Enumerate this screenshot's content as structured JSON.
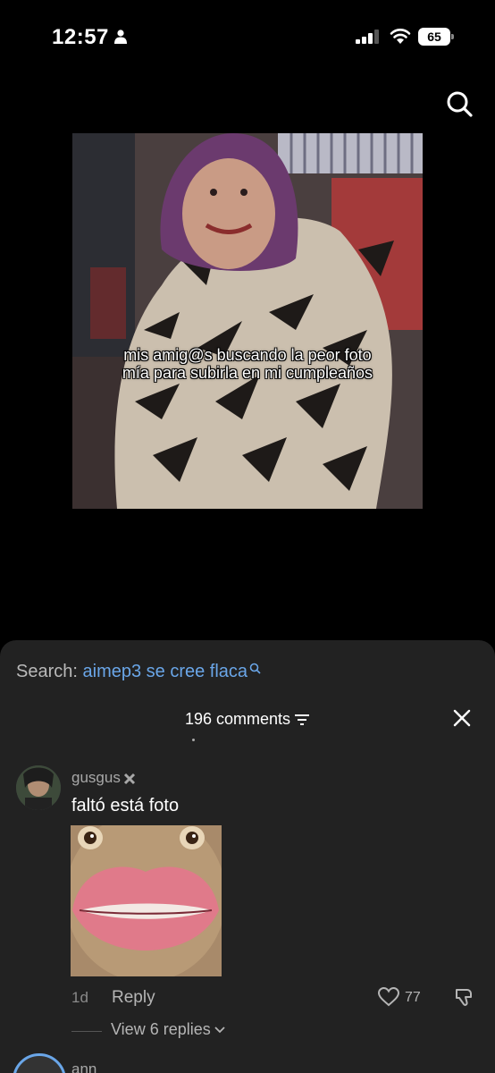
{
  "status_bar": {
    "time": "12:57",
    "battery": "65",
    "icons": [
      "person-icon",
      "signal-icon",
      "wifi-icon",
      "battery-icon"
    ]
  },
  "top_search_icon": "search-icon",
  "post": {
    "caption": "mis amig@s buscando la peor foto mía para subirla en mi cumpleaños"
  },
  "comments_panel": {
    "search_label": "Search:",
    "search_query": "aimep3 se cree flaca",
    "count_label": "196 comments",
    "comment": {
      "username": "gusgus",
      "text": "faltó está foto",
      "time": "1d",
      "reply_label": "Reply",
      "likes": "77",
      "view_replies": "View 6 replies"
    },
    "next_comment_username": "ann"
  },
  "colors": {
    "background": "#000000",
    "panel": "#222222",
    "link": "#6aa6e8",
    "muted": "#a8a8a8"
  }
}
